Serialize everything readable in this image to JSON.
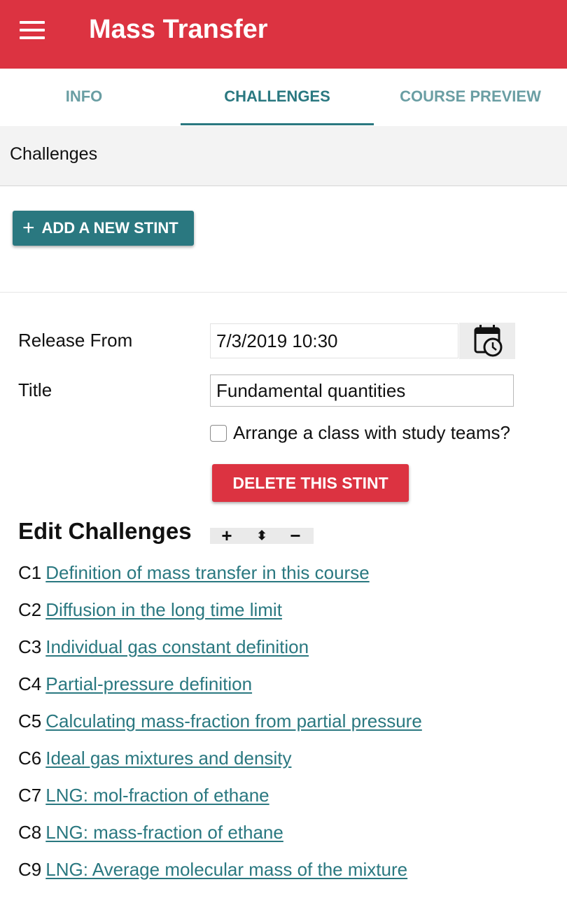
{
  "appbar": {
    "title": "Mass Transfer",
    "menu_icon": "hamburger-menu-icon",
    "color": "#dc3341"
  },
  "tabs": [
    {
      "label": "INFO",
      "active": false
    },
    {
      "label": "CHALLENGES",
      "active": true
    },
    {
      "label": "COURSE PREVIEW",
      "active": false
    }
  ],
  "section": {
    "title": "Challenges"
  },
  "add_stint": {
    "icon": "plus-icon",
    "label": "ADD A NEW STINT",
    "color": "#2a7880"
  },
  "form": {
    "release_label": "Release From",
    "release_value": "7/3/2019 10:30",
    "calendar_icon": "calendar-clock-icon",
    "title_label": "Title",
    "title_value": "Fundamental quantities",
    "checkbox_label": "Arrange a class with study teams?",
    "checkbox_checked": false
  },
  "delete_stint": {
    "label": "DELETE THIS STINT"
  },
  "edit_challenges": {
    "heading": "Edit Challenges",
    "controls": [
      {
        "symbol": "+",
        "icon": "add-icon"
      },
      {
        "symbol": "⬍",
        "icon": "reorder-icon"
      },
      {
        "symbol": "−",
        "icon": "remove-icon"
      }
    ]
  },
  "challenges": [
    {
      "id": "C1",
      "title": "Definition of mass transfer in this course"
    },
    {
      "id": "C2",
      "title": "Diffusion in the long time limit"
    },
    {
      "id": "C3",
      "title": "Individual gas constant definition"
    },
    {
      "id": "C4",
      "title": "Partial-pressure definition"
    },
    {
      "id": "C5",
      "title": "Calculating mass-fraction from partial pressure"
    },
    {
      "id": "C6",
      "title": "Ideal gas mixtures and density"
    },
    {
      "id": "C7",
      "title": "LNG: mol-fraction of ethane"
    },
    {
      "id": "C8",
      "title": "LNG: mass-fraction of ethane"
    },
    {
      "id": "C9",
      "title": "LNG: Average molecular mass of the mixture"
    }
  ]
}
